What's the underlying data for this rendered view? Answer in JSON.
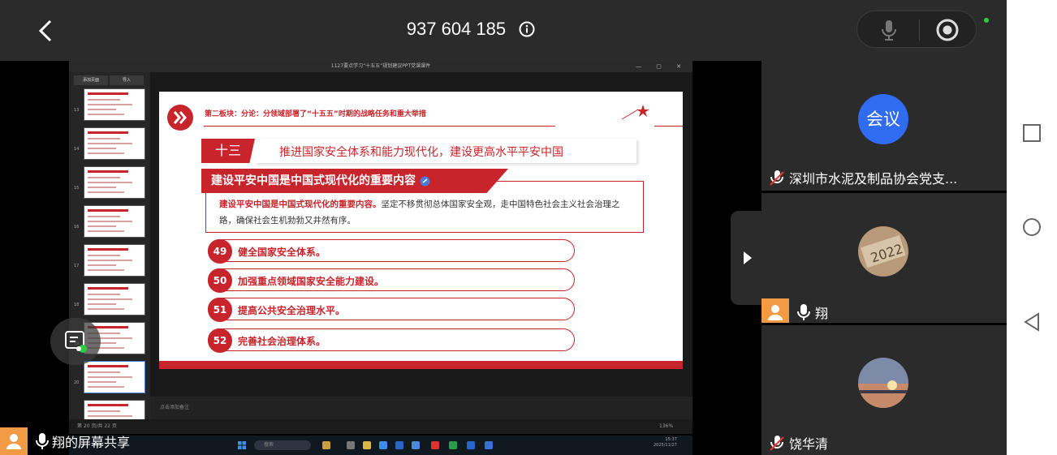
{
  "topbar": {
    "meeting_id": "937 604 185"
  },
  "window": {
    "title": "1127要点学习“十五五”规划建议PPT党课课件",
    "controls": "— ▢ ✕"
  },
  "thumbnails": {
    "tab_add": "添加页面",
    "tab_import": "导入",
    "numbers": [
      "13",
      "14",
      "15",
      "16",
      "17",
      "18",
      "19",
      "20",
      "21"
    ]
  },
  "slide": {
    "section_heading": "第二板块：分论：分领域部署了“十五五”时期的战略任务和重大举措",
    "section_number": "十三",
    "section_title": "推进国家安全体系和能力现代化，建设更高水平平安中国",
    "banner": "建设平安中国是中国式现代化的重要内容",
    "desc_bold": "建设平安中国是中国式现代化的重要内容。",
    "desc_rest": "坚定不移贯彻总体国家安全观，走中国特色社会主义社会治理之路，确保社会生机勃勃又井然有序。",
    "items": [
      {
        "num": "49",
        "text": "健全国家安全体系。"
      },
      {
        "num": "50",
        "text": "加强重点领域国家安全能力建设。"
      },
      {
        "num": "51",
        "text": "提高公共安全治理水平。"
      },
      {
        "num": "52",
        "text": "完善社会治理体系。"
      }
    ]
  },
  "notes": {
    "placeholder": "点击添加备注"
  },
  "status": {
    "page": "第 20 页/共 22 页",
    "zoom": "136%"
  },
  "taskbar": {
    "search": "搜索",
    "time": "15:37",
    "date": "2025/11/27"
  },
  "self_tag": {
    "label": "翔的屏幕共享"
  },
  "participants": [
    {
      "avatar_text": "会议",
      "name": "深圳市水泥及制品协会党支..."
    },
    {
      "name": "翔"
    },
    {
      "name": "饶华清"
    }
  ],
  "colors": {
    "accent_red": "#c8242b",
    "meeting_blue": "#2f6cf2",
    "avatar_orange": "#f39a44"
  }
}
